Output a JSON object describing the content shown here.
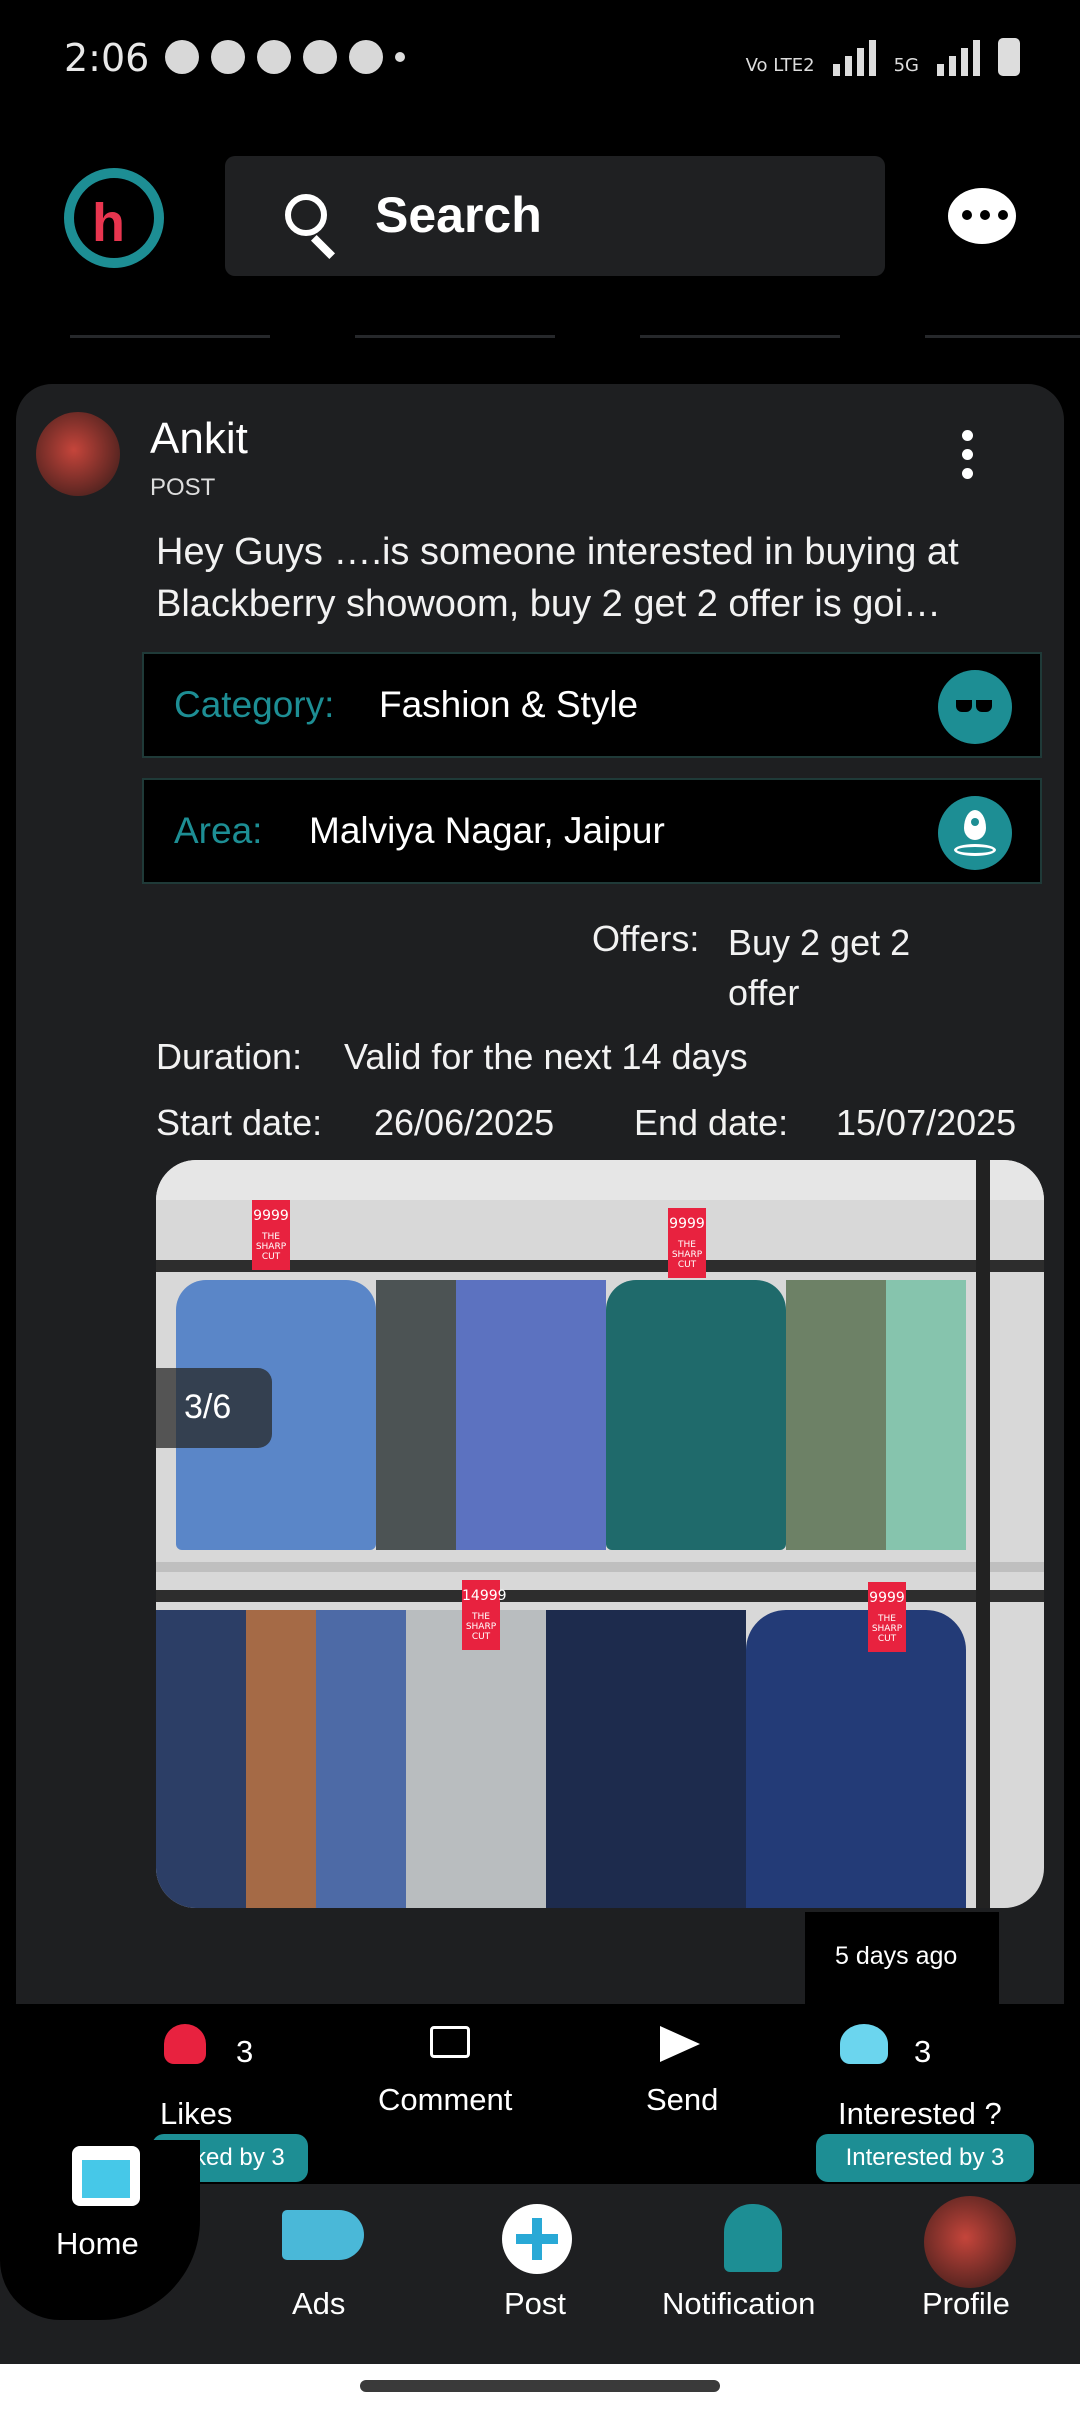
{
  "status_bar": {
    "time": "2:06",
    "network_left": "Vo LTE2",
    "network_right": "5G"
  },
  "header": {
    "search_label": "Search"
  },
  "post": {
    "author": "Ankit",
    "type": "POST",
    "text": "Hey Guys ….is someone interested in buying at Blackberry showoom, buy 2 get 2 offer is goi…",
    "category_label": "Category:",
    "category_value": "Fashion & Style",
    "area_label": "Area:",
    "area_value": "Malviya Nagar, Jaipur",
    "offers_label": "Offers:",
    "offers_value": "Buy 2 get 2 offer",
    "duration_label": "Duration:",
    "duration_value": "Valid for the next 14 days",
    "start_label": "Start date:",
    "start_value": "26/06/2025",
    "end_label": "End date:",
    "end_value": "15/07/2025",
    "image_counter": "3/6",
    "time_ago": "5 days ago",
    "price_tags": [
      "9999",
      "9999",
      "14999",
      "9999"
    ],
    "tag_caption": "THE SHARP CUT"
  },
  "actions": {
    "likes_count": "3",
    "likes_label": "Likes",
    "liked_by": "Liked by 3",
    "comment_label": "Comment",
    "send_label": "Send",
    "interested_count": "3",
    "interested_label": "Interested ?",
    "interested_by": "Interested by 3"
  },
  "nav": {
    "home": "Home",
    "ads": "Ads",
    "post": "Post",
    "notification": "Notification",
    "profile": "Profile"
  },
  "colors": {
    "accent": "#1d8e94",
    "brand_red": "#e8354f",
    "card_bg": "#1e1f21"
  }
}
